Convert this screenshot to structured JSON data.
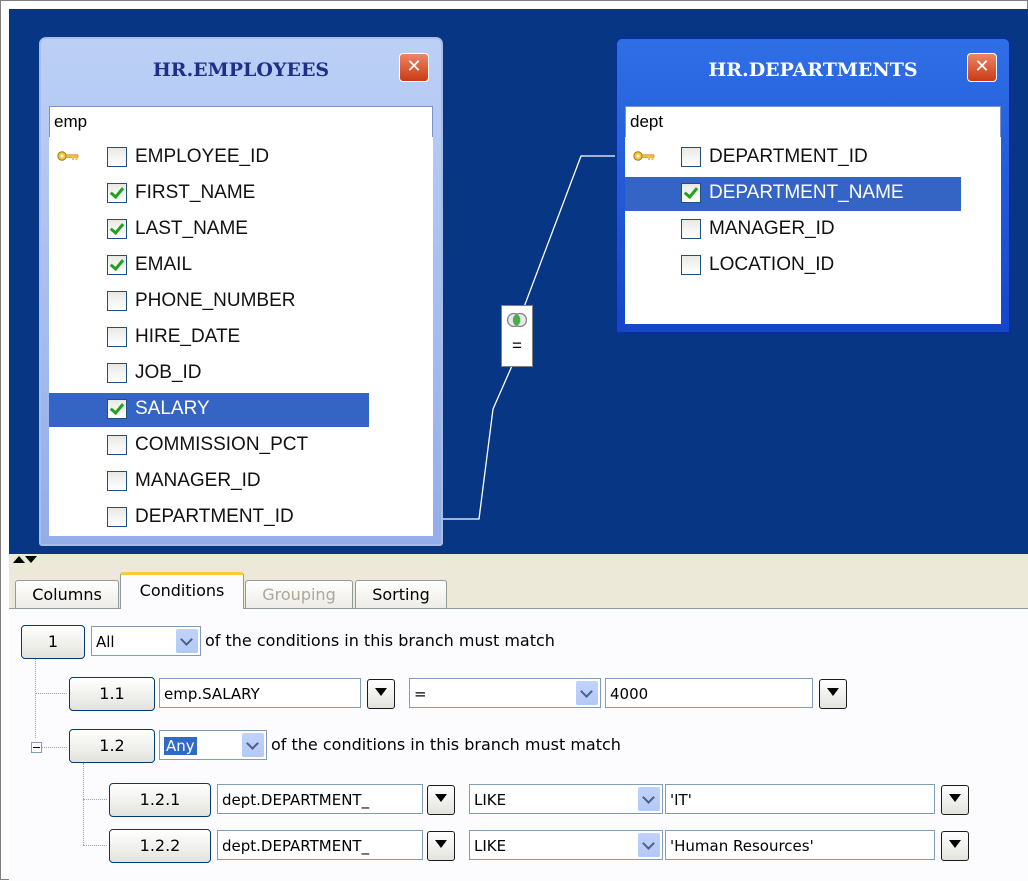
{
  "employees_table": {
    "title": "HR.EMPLOYEES",
    "alias": "emp",
    "columns": [
      {
        "name": "EMPLOYEE_ID",
        "checked": false,
        "key": true,
        "selected": false
      },
      {
        "name": "FIRST_NAME",
        "checked": true,
        "key": false,
        "selected": false
      },
      {
        "name": "LAST_NAME",
        "checked": true,
        "key": false,
        "selected": false
      },
      {
        "name": "EMAIL",
        "checked": true,
        "key": false,
        "selected": false
      },
      {
        "name": "PHONE_NUMBER",
        "checked": false,
        "key": false,
        "selected": false
      },
      {
        "name": "HIRE_DATE",
        "checked": false,
        "key": false,
        "selected": false
      },
      {
        "name": "JOB_ID",
        "checked": false,
        "key": false,
        "selected": false
      },
      {
        "name": "SALARY",
        "checked": true,
        "key": false,
        "selected": true
      },
      {
        "name": "COMMISSION_PCT",
        "checked": false,
        "key": false,
        "selected": false
      },
      {
        "name": "MANAGER_ID",
        "checked": false,
        "key": false,
        "selected": false
      },
      {
        "name": "DEPARTMENT_ID",
        "checked": false,
        "key": false,
        "selected": false
      }
    ]
  },
  "departments_table": {
    "title": "HR.DEPARTMENTS",
    "alias": "dept",
    "columns": [
      {
        "name": "DEPARTMENT_ID",
        "checked": false,
        "key": true,
        "selected": false
      },
      {
        "name": "DEPARTMENT_NAME",
        "checked": true,
        "key": false,
        "selected": true
      },
      {
        "name": "MANAGER_ID",
        "checked": false,
        "key": false,
        "selected": false
      },
      {
        "name": "LOCATION_ID",
        "checked": false,
        "key": false,
        "selected": false
      }
    ]
  },
  "join": {
    "operator": "="
  },
  "tabs": [
    {
      "label": "Columns",
      "state": "normal"
    },
    {
      "label": "Conditions",
      "state": "active"
    },
    {
      "label": "Grouping",
      "state": "disabled"
    },
    {
      "label": "Sorting",
      "state": "normal"
    }
  ],
  "conditions": {
    "root": {
      "id": "1",
      "match": "All",
      "text": "of the conditions in this branch must match"
    },
    "c11": {
      "id": "1.1",
      "field": "emp.SALARY",
      "operator": "=",
      "value": "4000"
    },
    "branch12": {
      "id": "1.2",
      "match": "Any",
      "text": "of the conditions in this branch must match"
    },
    "c121": {
      "id": "1.2.1",
      "field": "dept.DEPARTMENT_",
      "operator": "LIKE",
      "value": "'IT'"
    },
    "c122": {
      "id": "1.2.2",
      "field": "dept.DEPARTMENT_",
      "operator": "LIKE",
      "value": "'Human Resources'"
    }
  },
  "colors": {
    "canvas": "#063684",
    "selection": "#3565c4",
    "tab_accent": "#ffc83c"
  }
}
